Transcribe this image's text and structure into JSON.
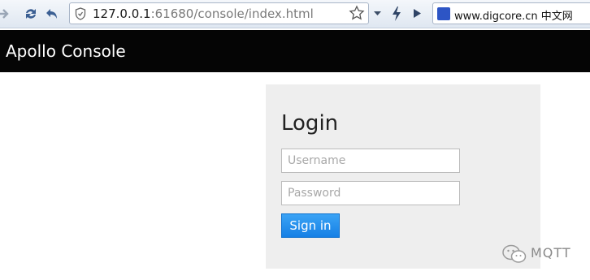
{
  "browser": {
    "url_host": "127.0.0.1",
    "url_rest": ":61680/console/index.html",
    "search_value": "www.digcore.cn 中文网"
  },
  "app": {
    "title": "Apollo Console"
  },
  "login": {
    "heading": "Login",
    "username_placeholder": "Username",
    "password_placeholder": "Password",
    "signin_label": "Sign in"
  },
  "watermark": {
    "text": "MQTT"
  },
  "colors": {
    "header_bg": "#050505",
    "panel_bg": "#eeeeee",
    "button_blue": "#1680e5"
  }
}
